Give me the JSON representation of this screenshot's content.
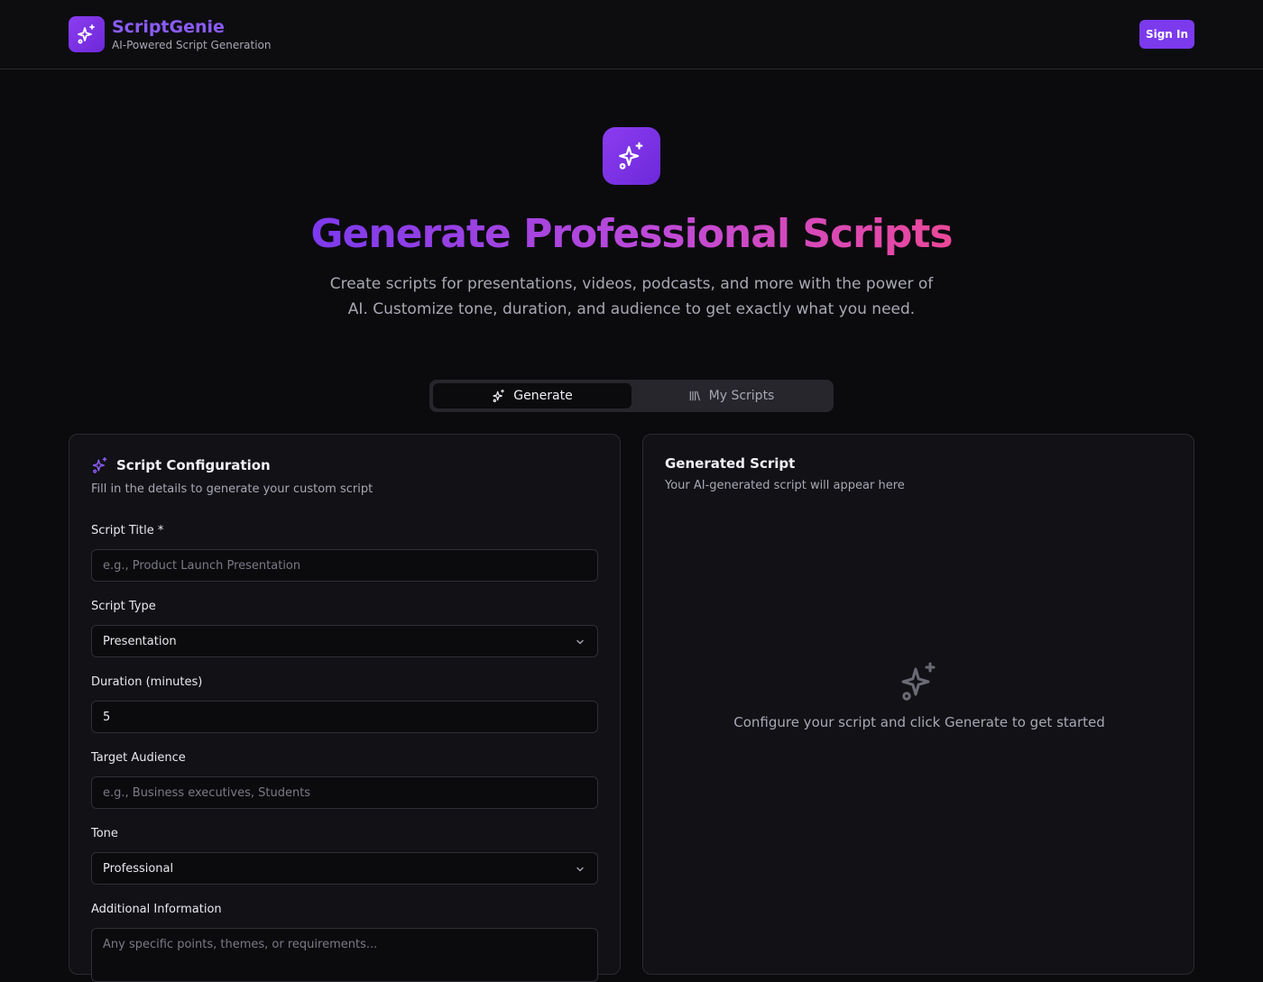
{
  "header": {
    "brand_name": "ScriptGenie",
    "tagline": "AI-Powered Script Generation",
    "signin_label": "Sign In",
    "accent": "#7c3aed"
  },
  "hero": {
    "title": "Generate Professional Scripts",
    "subtitle": "Create scripts for presentations, videos, podcasts, and more with the power of AI. Customize tone, duration, and audience to get exactly what you need."
  },
  "tabs": [
    {
      "label": "Generate",
      "icon": "sparkles-icon",
      "active": true
    },
    {
      "label": "My Scripts",
      "icon": "library-icon",
      "active": false
    }
  ],
  "config": {
    "title": "Script Configuration",
    "description": "Fill in the details to generate your custom script",
    "fields": {
      "script_title": {
        "label": "Script Title *",
        "placeholder": "e.g., Product Launch Presentation"
      },
      "script_type": {
        "label": "Script Type",
        "value": "Presentation"
      },
      "duration": {
        "label": "Duration (minutes)",
        "value": "5"
      },
      "audience": {
        "label": "Target Audience",
        "placeholder": "e.g., Business executives, Students"
      },
      "tone": {
        "label": "Tone",
        "value": "Professional"
      },
      "additional": {
        "label": "Additional Information",
        "placeholder": "Any specific points, themes, or requirements..."
      }
    }
  },
  "output": {
    "title": "Generated Script",
    "description": "Your AI-generated script will appear here",
    "empty_message": "Configure your script and click Generate to get started"
  }
}
